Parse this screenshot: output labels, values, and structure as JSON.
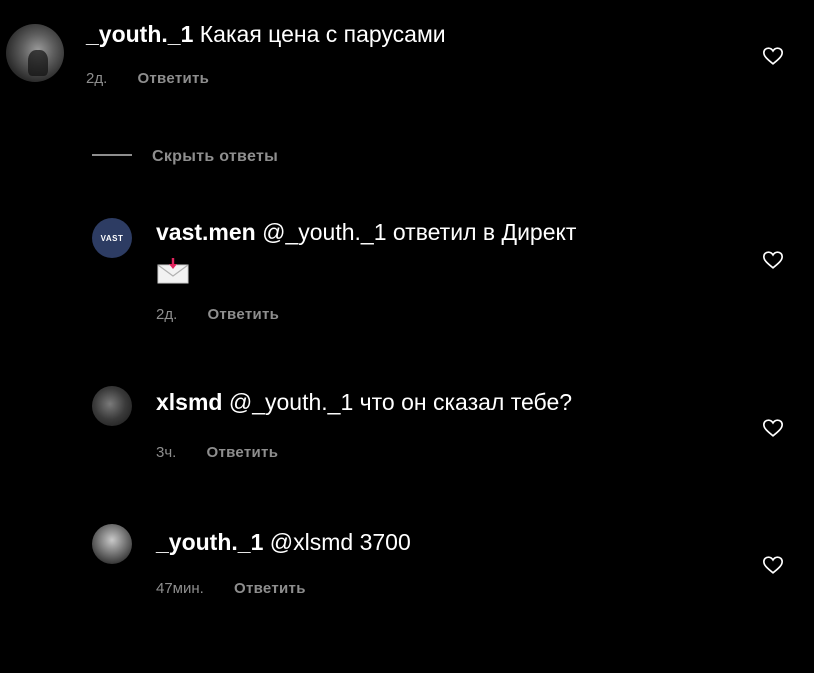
{
  "comments": [
    {
      "username": "_youth._1",
      "text": "Какая цена с парусами",
      "time": "2д.",
      "reply_label": "Ответить"
    },
    {
      "username": "vast.men",
      "text": "@_youth._1 ответил в Директ",
      "time": "2д.",
      "reply_label": "Ответить",
      "avatar_text": "VAST"
    },
    {
      "username": "xlsmd",
      "text": "@_youth._1 что он сказал тебе?",
      "time": "3ч.",
      "reply_label": "Ответить"
    },
    {
      "username": "_youth._1",
      "text": "@xlsmd 3700",
      "time": "47мин.",
      "reply_label": "Ответить"
    }
  ],
  "hide_replies_label": "Скрыть ответы",
  "icons": {
    "like": "heart-outline-icon",
    "envelope": "envelope-with-arrow-icon"
  },
  "colors": {
    "background": "#000000",
    "text": "#ffffff",
    "muted": "#8e8e8e"
  }
}
